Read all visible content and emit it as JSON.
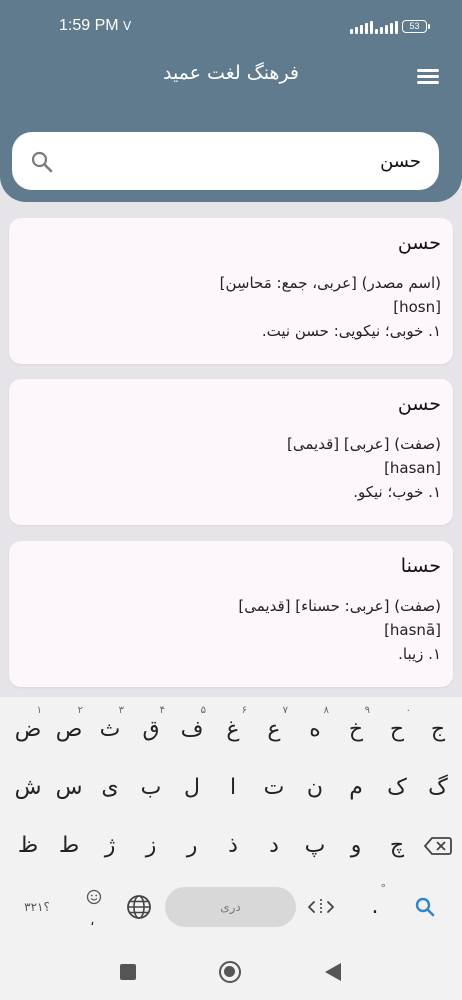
{
  "status": {
    "time": "1:59 PM",
    "indicator": "V",
    "battery": "53"
  },
  "header": {
    "title": "فرهنگ لغت عمید",
    "menu_icon": "hamburger-menu-icon"
  },
  "search": {
    "value": "حسن",
    "icon": "search-icon"
  },
  "results": [
    {
      "word": "حسن",
      "lines": [
        "(اسم مصدر) [عربی، جمع: مَحاسِن]",
        "[hosn]",
        "۱. خوبی؛ نیکویی: حسن نیت."
      ]
    },
    {
      "word": "حسن",
      "lines": [
        "(صفت) [عربی] [قدیمی]",
        "[hasan]",
        "۱. خوب؛ نیکو."
      ]
    },
    {
      "word": "حسنا",
      "lines": [
        "(صفت) [عربی: حسناء] [قدیمی]",
        "[hasnā]",
        "۱. زیبا."
      ]
    }
  ],
  "keyboard": {
    "row1": [
      {
        "key": "ج",
        "hint": ""
      },
      {
        "key": "ح",
        "hint": "۰"
      },
      {
        "key": "خ",
        "hint": "۹"
      },
      {
        "key": "ه",
        "hint": "۸"
      },
      {
        "key": "ع",
        "hint": "۷"
      },
      {
        "key": "غ",
        "hint": "۶"
      },
      {
        "key": "ف",
        "hint": "۵"
      },
      {
        "key": "ق",
        "hint": "۴"
      },
      {
        "key": "ث",
        "hint": "۳"
      },
      {
        "key": "ص",
        "hint": "۲"
      },
      {
        "key": "ض",
        "hint": "۱"
      }
    ],
    "row2": [
      "گ",
      "ک",
      "م",
      "ن",
      "ت",
      "ا",
      "ل",
      "ب",
      "ی",
      "س",
      "ش"
    ],
    "row3": [
      "چ",
      "و",
      "پ",
      "د",
      "ذ",
      "ر",
      "ز",
      "ژ",
      "ط",
      "ظ"
    ],
    "symbols_label": "؟۳۲۱",
    "emoji_hint": "،",
    "space_label": "دری",
    "period_label": ".",
    "period_hint": "°",
    "icons": {
      "backspace": "backspace-icon",
      "globe": "globe-icon",
      "emoji": "emoji-icon",
      "cursor": "cursor-move-icon",
      "search": "keyboard-search-icon"
    }
  },
  "navigation": {
    "icons": [
      "recent-apps-icon",
      "home-icon",
      "back-icon"
    ]
  },
  "colors": {
    "header": "#5f7b8d",
    "accent": "#2f86c8",
    "card": "#fdf7fc",
    "background": "#e6e4e8"
  }
}
